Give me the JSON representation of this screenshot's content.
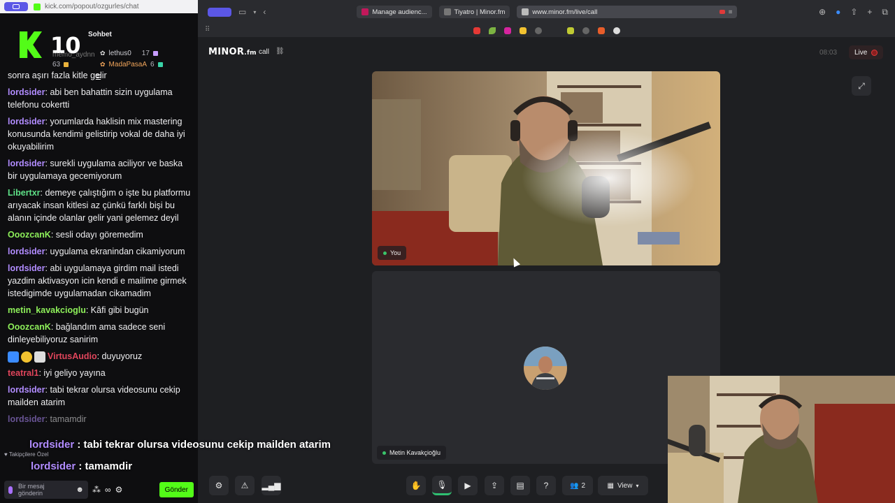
{
  "chat_window": {
    "url": "kick.com/popout/ozgurles/chat",
    "title": "Sohbet",
    "logo_number": "10",
    "leaderboard": [
      {
        "name": "lethus0",
        "count": "17"
      },
      {
        "name": "MadaPasaA",
        "count": "6"
      },
      {
        "name": "memo_aydnn",
        "count": "63"
      }
    ],
    "messages": [
      {
        "user": "",
        "text": "sonra aşırı fazla kitle gelir",
        "color": "#efeff1"
      },
      {
        "user": "lordsider",
        "text": ": abi ben bahattin sizin uygulama telefonu cokertti",
        "color": "#b18cff"
      },
      {
        "user": "lordsider",
        "text": ": yorumlarda haklisin mix mastering konusunda kendimi gelistirip vokal de daha iyi okuyabilirim",
        "color": "#b18cff"
      },
      {
        "user": "lordsider",
        "text": ": surekli uygulama aciliyor ve baska bir uygulamaya gecemiyorum",
        "color": "#b18cff"
      },
      {
        "user": "Libertxr",
        "text": ": demeye çalıştığım o işte bu platformu arıyacak insan kitlesi az çünkü farklı bişi bu alanın içinde olanlar gelir yani gelemez deyil",
        "color": "#5ee087"
      },
      {
        "user": "OoozcanK",
        "text": ": sesli odayı göremedim",
        "color": "#8ef05a"
      },
      {
        "user": "lordsider",
        "text": ": uygulama ekranindan cikamiyorum",
        "color": "#b18cff"
      },
      {
        "user": "lordsider",
        "text": ": abi uygulamaya girdim mail istedi yazdim aktivasyon icin kendi e mailime girmek istedigimde uygulamadan cikamadim",
        "color": "#b18cff"
      },
      {
        "user": "metin_kavakcioglu",
        "text": ": Kâfi gibi bugün",
        "color": "#8ef05a"
      },
      {
        "user": "OoozcanK",
        "text": ": bağlandım ama sadece seni dinleyebiliyoruz sanirim",
        "color": "#8ef05a"
      },
      {
        "user": "VirtusAudio",
        "text": ": duyuyoruz",
        "color": "#e0455b"
      },
      {
        "user": "teatral1",
        "text": ": iyi geliyo yayına",
        "color": "#e0455b"
      },
      {
        "user": "lordsider",
        "text": ": tabi tekrar olursa videosunu cekip mailden atarim",
        "color": "#b18cff"
      },
      {
        "user": "lordsider",
        "text": ": tamamdir",
        "color": "#b18cff"
      }
    ],
    "overlay_caption_1": {
      "user": "lordsider",
      "text": " : tabi tekrar olursa videosunu cekip mailden atarim"
    },
    "overlay_caption_2": {
      "user": "lordsider",
      "text": " : tamamdir"
    },
    "followers_only": "Takipçilere Özel",
    "input_placeholder": "Bir mesaj gönderin",
    "send_label": "Gönder"
  },
  "browser": {
    "tabs": [
      {
        "label": "Manage audienc...",
        "color": "#c2185b"
      },
      {
        "label": "Tiyatro | Minor.fm",
        "color": "#777"
      },
      {
        "label": "www.minor.fm/live/call",
        "color": "#999"
      }
    ]
  },
  "minor_app": {
    "logo": "MINOR",
    "logo_suffix": ".fm",
    "call_label": "call",
    "timer": "08:03",
    "live_label": "Live",
    "you_label": "You",
    "remote_name": "Metin Kavakçioğlu",
    "participants_count": "2",
    "view_label": "View"
  },
  "colors": {
    "accent": "#5b57e6",
    "kick_green": "#53fc18",
    "mic_active": "#2fbf71",
    "live_red": "#e03a3a"
  }
}
